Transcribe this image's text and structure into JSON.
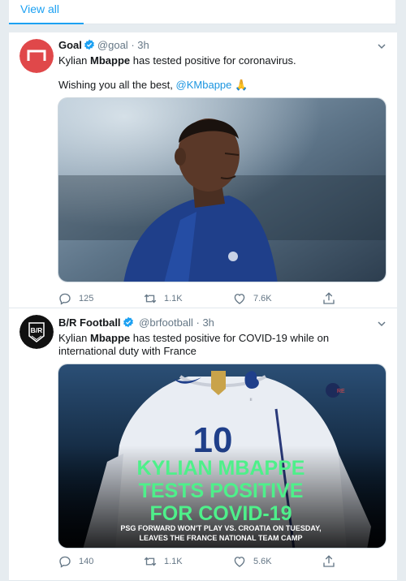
{
  "top": {
    "view_all": "View all"
  },
  "tweets": [
    {
      "name": "Goal",
      "handle": "@goal",
      "dot": "·",
      "time": "3h",
      "text_line1_pre": "Kylian ",
      "text_line1_bold": "Mbappe",
      "text_line1_post": " has tested positive for coronavirus.",
      "text_line2_pre": "Wishing you all the best, ",
      "text_line2_mention": "@KMbappe",
      "text_line2_emoji": "🙏",
      "replies": "125",
      "retweets": "1.1K",
      "likes": "7.6K"
    },
    {
      "name": "B/R Football",
      "handle": "@brfootball",
      "dot": "·",
      "time": "3h",
      "avatar_text": "B/R",
      "text_line1_pre": "Kylian ",
      "text_line1_bold": "Mbappe",
      "text_line1_post": " has tested positive for COVID-19 while on",
      "text_line2": "international duty with France",
      "graphic_number": "10",
      "graphic_headline_1": "KYLIAN MBAPPE",
      "graphic_headline_2": "TESTS POSITIVE",
      "graphic_headline_3": "FOR COVID-19",
      "graphic_sub_1": "PSG FORWARD WON'T PLAY VS. CROATIA ON TUESDAY,",
      "graphic_sub_2": "LEAVES THE FRANCE NATIONAL TEAM CAMP",
      "replies": "140",
      "retweets": "1.1K",
      "likes": "5.6K"
    }
  ],
  "colors": {
    "link": "#1b95e0",
    "muted": "#657786",
    "graphic_green": "#4ef08a",
    "goal_red": "#e0484a"
  }
}
